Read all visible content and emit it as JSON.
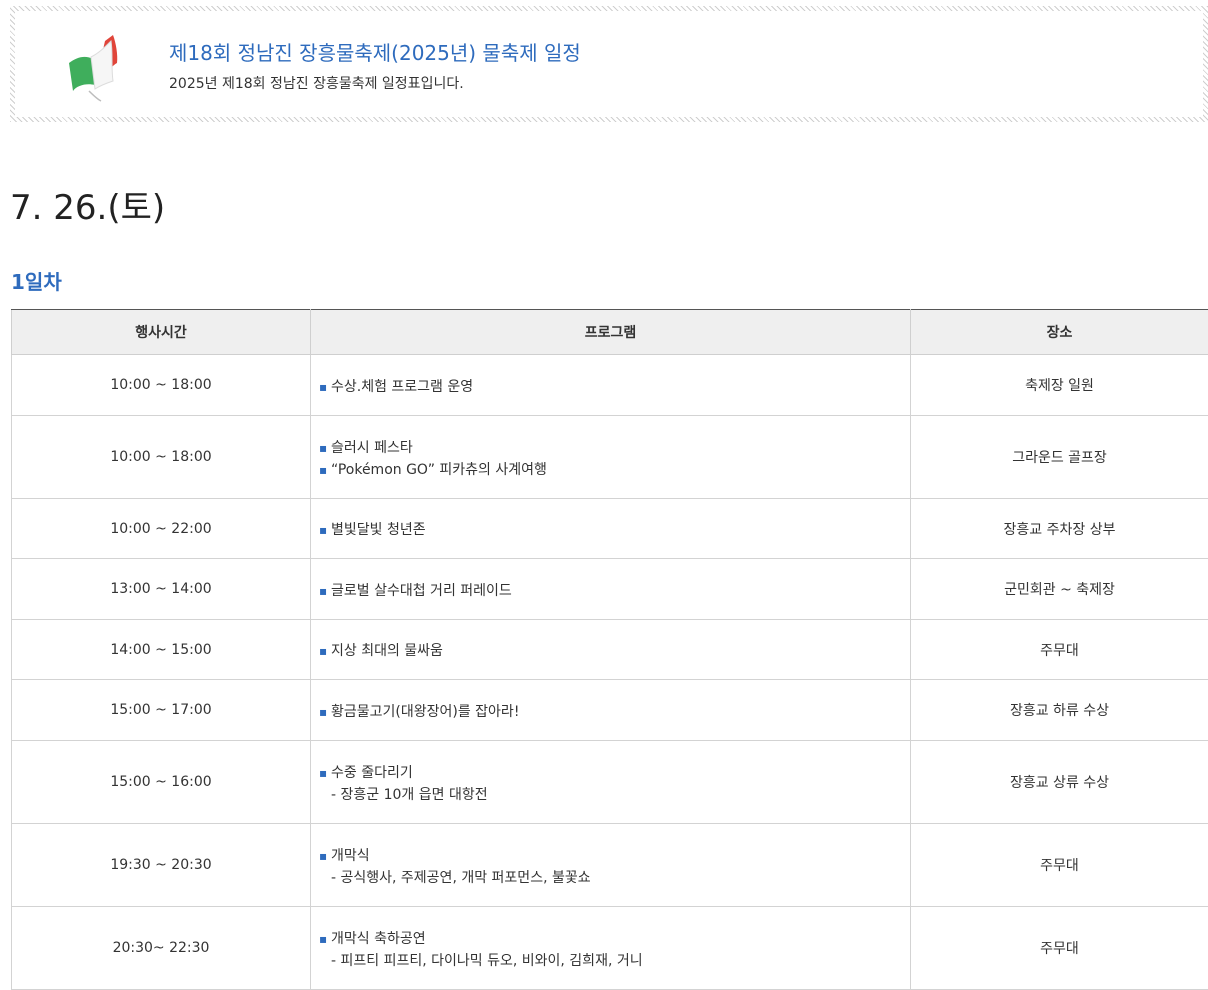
{
  "header": {
    "title": "제18회 정남진 장흥물축제(2025년) 물축제 일정",
    "subtitle": "2025년 제18회 정남진 장흥물축제 일정표입니다."
  },
  "date_title": "7. 26.(토)",
  "day_label": "1일차",
  "colors": {
    "accent": "#2e6bbd",
    "flag_green": "#3fae5c",
    "flag_red": "#e0453a"
  },
  "icons": {
    "header": "flag-icon"
  },
  "table": {
    "headers": [
      "행사시간",
      "프로그램",
      "장소"
    ],
    "rows": [
      {
        "time": "10:00 ~ 18:00",
        "programs": [
          {
            "type": "bullet",
            "text": "수상.체험 프로그램 운영"
          }
        ],
        "place": "축제장 일원",
        "height": 61
      },
      {
        "time": "10:00 ~ 18:00",
        "programs": [
          {
            "type": "bullet",
            "text": "슬러시 페스타"
          },
          {
            "type": "bullet",
            "text": "“Pokémon GO” 피카츄의 사계여행"
          }
        ],
        "place": "그라운드 골프장",
        "height": 83
      },
      {
        "time": "10:00 ~ 22:00",
        "programs": [
          {
            "type": "bullet",
            "text": "별빛달빛 청년존"
          }
        ],
        "place": "장흥교 주차장 상부",
        "height": 60
      },
      {
        "time": "13:00 ~ 14:00",
        "programs": [
          {
            "type": "bullet",
            "text": "글로벌 살수대첩 거리 퍼레이드"
          }
        ],
        "place": "군민회관 ~ 축제장",
        "height": 61
      },
      {
        "time": "14:00 ~ 15:00",
        "programs": [
          {
            "type": "bullet",
            "text": "지상 최대의 물싸움"
          }
        ],
        "place": "주무대",
        "height": 60
      },
      {
        "time": "15:00 ~ 17:00",
        "programs": [
          {
            "type": "bullet",
            "text": "황금물고기(대왕장어)를 잡아라!"
          }
        ],
        "place": "장흥교 하류 수상",
        "height": 61
      },
      {
        "time": "15:00 ~ 16:00",
        "programs": [
          {
            "type": "bullet",
            "text": "수중 줄다리기"
          },
          {
            "type": "sub",
            "text": "- 장흥군 10개 읍면 대항전"
          }
        ],
        "place": "장흥교 상류 수상",
        "height": 83
      },
      {
        "time": "19:30 ~ 20:30",
        "programs": [
          {
            "type": "bullet",
            "text": "개막식"
          },
          {
            "type": "sub",
            "text": "- 공식행사, 주제공연, 개막 퍼포먼스, 불꽃쇼"
          }
        ],
        "place": "주무대",
        "height": 83
      },
      {
        "time": "20:30~ 22:30",
        "programs": [
          {
            "type": "bullet",
            "text": "개막식 축하공연"
          },
          {
            "type": "sub",
            "text": "- 피프티 피프티, 다이나믹 듀오, 비와이, 김희재, 거니"
          }
        ],
        "place": "주무대",
        "height": 83
      }
    ]
  }
}
